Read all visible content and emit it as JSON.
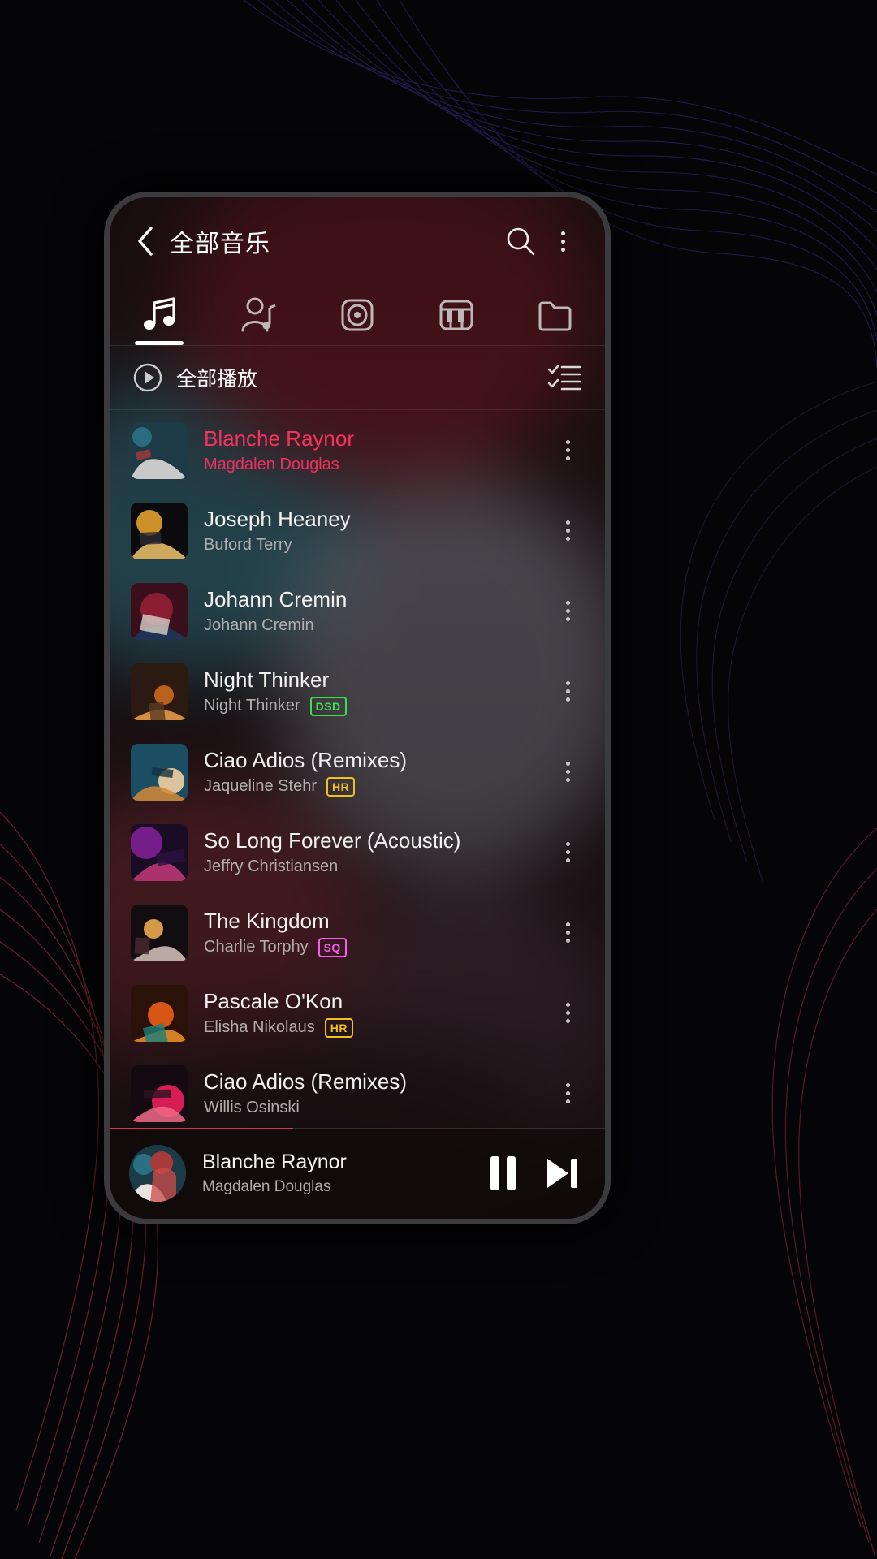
{
  "header": {
    "title": "全部音乐",
    "back_icon": "chevron-left-icon",
    "search_icon": "search-icon",
    "overflow_icon": "kebab-menu-icon"
  },
  "tabs": [
    {
      "name": "songs",
      "icon": "music-note-icon",
      "active": true
    },
    {
      "name": "artists",
      "icon": "artist-icon",
      "active": false
    },
    {
      "name": "albums",
      "icon": "album-disc-icon",
      "active": false
    },
    {
      "name": "genres",
      "icon": "piano-keys-icon",
      "active": false
    },
    {
      "name": "folders",
      "icon": "folder-icon",
      "active": false
    }
  ],
  "toolbar": {
    "play_all_label": "全部播放",
    "play_all_icon": "play-circle-icon",
    "multi_select_icon": "checklist-icon"
  },
  "songs": [
    {
      "title": "Blanche Raynor",
      "artist": "Magdalen Douglas",
      "badge": "",
      "playing": true
    },
    {
      "title": "Joseph Heaney",
      "artist": "Buford Terry",
      "badge": "",
      "playing": false
    },
    {
      "title": "Johann Cremin",
      "artist": "Johann Cremin",
      "badge": "",
      "playing": false
    },
    {
      "title": "Night Thinker",
      "artist": "Night Thinker",
      "badge": "DSD",
      "playing": false
    },
    {
      "title": "Ciao Adios (Remixes)",
      "artist": "Jaqueline Stehr",
      "badge": "HR",
      "playing": false
    },
    {
      "title": "So Long Forever (Acoustic)",
      "artist": "Jeffry Christiansen",
      "badge": "",
      "playing": false
    },
    {
      "title": "The Kingdom",
      "artist": "Charlie Torphy",
      "badge": "SQ",
      "playing": false
    },
    {
      "title": "Pascale O'Kon",
      "artist": "Elisha Nikolaus",
      "badge": "HR",
      "playing": false
    },
    {
      "title": "Ciao Adios (Remixes)",
      "artist": "Willis Osinski",
      "badge": "",
      "playing": false
    }
  ],
  "now_playing": {
    "title": "Blanche Raynor",
    "artist": "Magdalen Douglas",
    "pause_icon": "pause-icon",
    "next_icon": "next-track-icon",
    "progress_percent": 37
  },
  "colors": {
    "accent": "#f4335f",
    "badge_dsd": "#3ee04a",
    "badge_hr": "#f0c020",
    "badge_sq": "#f45cf0",
    "progress": "#e0304f"
  }
}
